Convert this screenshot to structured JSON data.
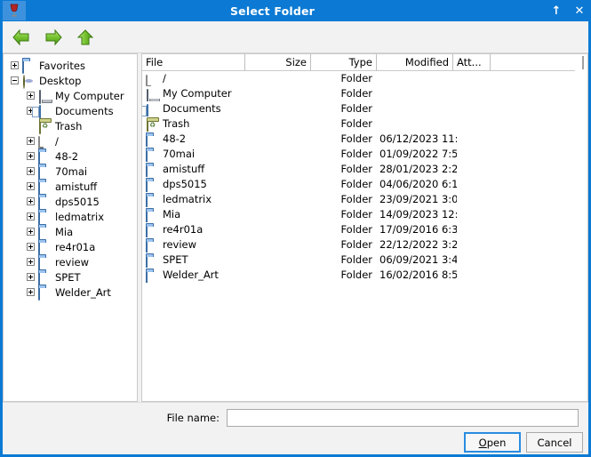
{
  "window": {
    "title": "Select Folder",
    "app_icon": "wine-glass-icon",
    "controls": [
      {
        "name": "maximize-button",
        "glyph": "↑"
      },
      {
        "name": "close-button",
        "glyph": "✕"
      }
    ]
  },
  "toolbar": {
    "buttons": [
      {
        "name": "back-button",
        "icon": "green-left-arrow-icon"
      },
      {
        "name": "forward-button",
        "icon": "green-right-arrow-icon"
      },
      {
        "name": "up-button",
        "icon": "green-up-arrow-icon"
      }
    ]
  },
  "tree": {
    "items": [
      {
        "label": "Favorites",
        "icon": "folder-icon",
        "expander": "plus",
        "indent": 0
      },
      {
        "label": "Desktop",
        "icon": "desktop-icon",
        "expander": "minus",
        "indent": 0
      },
      {
        "label": "My Computer",
        "icon": "computer-icon",
        "expander": "plus",
        "indent": 1
      },
      {
        "label": "Documents",
        "icon": "documents-icon",
        "expander": "plus",
        "indent": 1
      },
      {
        "label": "Trash",
        "icon": "trash-icon",
        "expander": "none",
        "indent": 1
      },
      {
        "label": "/",
        "icon": "drive-icon",
        "expander": "plus",
        "indent": 1
      },
      {
        "label": "48-2",
        "icon": "folder-icon",
        "expander": "plus",
        "indent": 1
      },
      {
        "label": "70mai",
        "icon": "folder-icon",
        "expander": "plus",
        "indent": 1
      },
      {
        "label": "amistuff",
        "icon": "folder-icon",
        "expander": "plus",
        "indent": 1
      },
      {
        "label": "dps5015",
        "icon": "folder-icon",
        "expander": "plus",
        "indent": 1
      },
      {
        "label": "ledmatrix",
        "icon": "folder-icon",
        "expander": "plus",
        "indent": 1
      },
      {
        "label": "Mia",
        "icon": "folder-icon",
        "expander": "plus",
        "indent": 1
      },
      {
        "label": "re4r01a",
        "icon": "folder-icon",
        "expander": "plus",
        "indent": 1
      },
      {
        "label": "review",
        "icon": "folder-icon",
        "expander": "plus",
        "indent": 1
      },
      {
        "label": "SPET",
        "icon": "folder-icon",
        "expander": "plus",
        "indent": 1
      },
      {
        "label": "Welder_Art",
        "icon": "folder-icon",
        "expander": "plus",
        "indent": 1
      }
    ]
  },
  "list": {
    "columns": [
      {
        "key": "file",
        "label": "File"
      },
      {
        "key": "size",
        "label": "Size"
      },
      {
        "key": "type",
        "label": "Type"
      },
      {
        "key": "modified",
        "label": "Modified"
      },
      {
        "key": "att",
        "label": "Att..."
      }
    ],
    "rows": [
      {
        "file": "/",
        "icon": "drive-icon",
        "size": "",
        "type": "Folder",
        "modified": "",
        "att": ""
      },
      {
        "file": "My Computer",
        "icon": "computer-icon",
        "size": "",
        "type": "Folder",
        "modified": "",
        "att": ""
      },
      {
        "file": "Documents",
        "icon": "documents-icon",
        "size": "",
        "type": "Folder",
        "modified": "",
        "att": ""
      },
      {
        "file": "Trash",
        "icon": "trash-icon",
        "size": "",
        "type": "Folder",
        "modified": "",
        "att": ""
      },
      {
        "file": "48-2",
        "icon": "folder-icon",
        "size": "",
        "type": "Folder",
        "modified": "06/12/2023 11:..",
        "att": ""
      },
      {
        "file": "70mai",
        "icon": "folder-icon",
        "size": "",
        "type": "Folder",
        "modified": "01/09/2022 7:5..",
        "att": ""
      },
      {
        "file": "amistuff",
        "icon": "folder-icon",
        "size": "",
        "type": "Folder",
        "modified": "28/01/2023 2:2..",
        "att": ""
      },
      {
        "file": "dps5015",
        "icon": "folder-icon",
        "size": "",
        "type": "Folder",
        "modified": "04/06/2020 6:1..",
        "att": ""
      },
      {
        "file": "ledmatrix",
        "icon": "folder-icon",
        "size": "",
        "type": "Folder",
        "modified": "23/09/2021 3:0..",
        "att": ""
      },
      {
        "file": "Mia",
        "icon": "folder-icon",
        "size": "",
        "type": "Folder",
        "modified": "14/09/2023 12:..",
        "att": ""
      },
      {
        "file": "re4r01a",
        "icon": "folder-icon",
        "size": "",
        "type": "Folder",
        "modified": "17/09/2016 6:3..",
        "att": ""
      },
      {
        "file": "review",
        "icon": "folder-icon",
        "size": "",
        "type": "Folder",
        "modified": "22/12/2022 3:2..",
        "att": ""
      },
      {
        "file": "SPET",
        "icon": "folder-icon",
        "size": "",
        "type": "Folder",
        "modified": "06/09/2021 3:4..",
        "att": ""
      },
      {
        "file": "Welder_Art",
        "icon": "folder-icon",
        "size": "",
        "type": "Folder",
        "modified": "16/02/2016 8:5..",
        "att": ""
      }
    ]
  },
  "bottom": {
    "filename_label": "File name:",
    "filename_value": "",
    "filename_placeholder": "",
    "open_label": "Open",
    "open_mnemonic": "O",
    "open_rest": "pen",
    "cancel_label": "Cancel"
  },
  "colors": {
    "titlebar": "#0c7ad4",
    "window_bg": "#f2f2f2",
    "panel_bg": "#ffffff",
    "accent": "#2a8ce0",
    "arrow_green": "#5aba2a"
  }
}
